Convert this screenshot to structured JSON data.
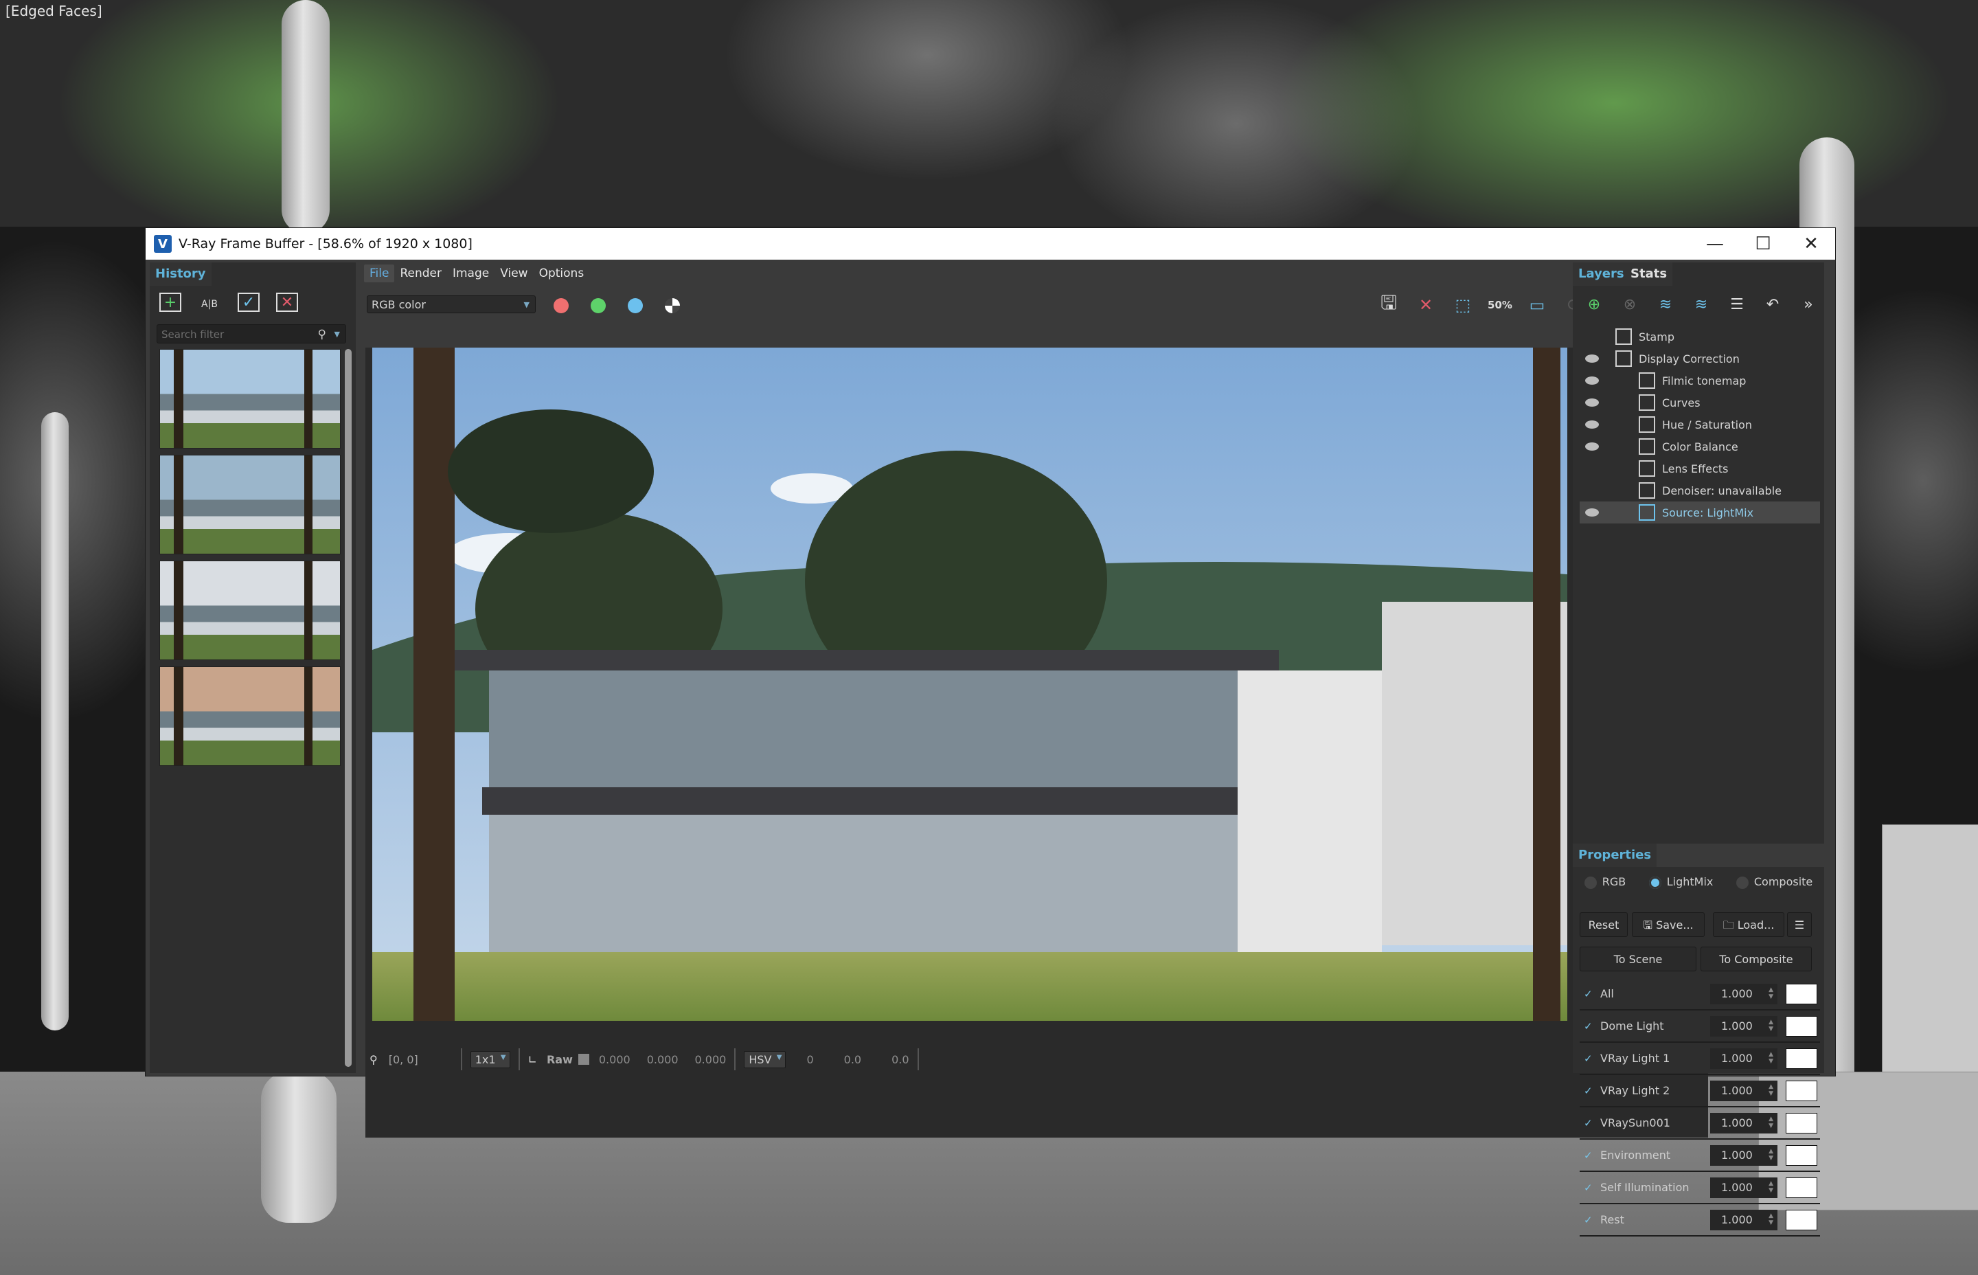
{
  "viewport": {
    "label": "[Edged Faces]"
  },
  "window": {
    "title": "V-Ray Frame Buffer - [58.6% of 1920 x 1080]",
    "controls": {
      "minimize": "—",
      "maximize": "☐",
      "close": "✕"
    }
  },
  "history": {
    "tab_label": "History",
    "tools": [
      "add-to-history-icon",
      "compare-ab-icon",
      "load-history-icon",
      "remove-history-icon"
    ],
    "search_placeholder": "Search filter",
    "thumbnails": [
      {
        "name": "history-thumbnail-1",
        "sky": "#a9c6df"
      },
      {
        "name": "history-thumbnail-2",
        "sky": "#9bb6cb"
      },
      {
        "name": "history-thumbnail-3",
        "sky": "#d9dde2"
      },
      {
        "name": "history-thumbnail-4",
        "sky": "#c8a48b"
      }
    ]
  },
  "menu": {
    "items": [
      "File",
      "Render",
      "Image",
      "View",
      "Options"
    ],
    "active": "File"
  },
  "toolbar": {
    "channel_select": "RGB color",
    "channel_dots": [
      {
        "name": "red-channel",
        "color": "#f07070"
      },
      {
        "name": "green-channel",
        "color": "#5ed26a"
      },
      {
        "name": "blue-channel",
        "color": "#6cc0ee"
      }
    ],
    "zoom_label": "50%"
  },
  "statusbar": {
    "coords": "[0, 0]",
    "sample_size": "1x1",
    "raw_label": "Raw",
    "raw_values": [
      "0.000",
      "0.000",
      "0.000"
    ],
    "color_mode": "HSV",
    "hsv_values": [
      "0",
      "0.0",
      "0.0"
    ]
  },
  "layers": {
    "tabs": [
      "Layers",
      "Stats"
    ],
    "items": [
      {
        "label": "Stamp",
        "visible": false,
        "indent": 0,
        "icon": "stamp-icon"
      },
      {
        "label": "Display Correction",
        "visible": true,
        "indent": 0,
        "icon": "display-correction-icon"
      },
      {
        "label": "Filmic tonemap",
        "visible": true,
        "indent": 1,
        "icon": "filmic-tonemap-icon"
      },
      {
        "label": "Curves",
        "visible": true,
        "indent": 1,
        "icon": "curves-icon"
      },
      {
        "label": "Hue / Saturation",
        "visible": true,
        "indent": 1,
        "icon": "hue-saturation-icon"
      },
      {
        "label": "Color Balance",
        "visible": true,
        "indent": 1,
        "icon": "color-balance-icon"
      },
      {
        "label": "Lens Effects",
        "visible": false,
        "indent": 1,
        "icon": "lens-effects-icon"
      },
      {
        "label": "Denoiser: unavailable",
        "visible": false,
        "indent": 1,
        "icon": "denoiser-icon"
      },
      {
        "label": "Source: LightMix",
        "visible": true,
        "indent": 1,
        "icon": "lightmix-icon",
        "selected": true
      }
    ]
  },
  "properties": {
    "tab_label": "Properties",
    "modes": [
      "RGB",
      "LightMix",
      "Composite"
    ],
    "selected_mode": "LightMix",
    "buttons": {
      "reset": "Reset",
      "save": "Save...",
      "load": "Load...",
      "to_scene": "To Scene",
      "to_composite": "To Composite"
    },
    "lights": [
      {
        "label": "All",
        "checked": true,
        "value": "1.000",
        "color": "#ffffff"
      },
      {
        "label": "Dome Light",
        "checked": true,
        "value": "1.000",
        "color": "#ffffff"
      },
      {
        "label": "VRay Light 1",
        "checked": true,
        "value": "1.000",
        "color": "#ffffff"
      },
      {
        "label": "VRay Light 2",
        "checked": true,
        "value": "1.000",
        "color": "#ffffff"
      },
      {
        "label": "VRaySun001",
        "checked": true,
        "value": "1.000",
        "color": "#ffffff"
      },
      {
        "label": "Environment",
        "checked": true,
        "value": "1.000",
        "color": "#ffffff"
      },
      {
        "label": "Self Illumination",
        "checked": true,
        "value": "1.000",
        "color": "#ffffff"
      },
      {
        "label": "Rest",
        "checked": true,
        "value": "1.000",
        "color": "#ffffff"
      }
    ]
  },
  "colors": {
    "accent": "#5fb3d9",
    "panel": "#2e2e2e",
    "window": "#3a3a3a"
  }
}
